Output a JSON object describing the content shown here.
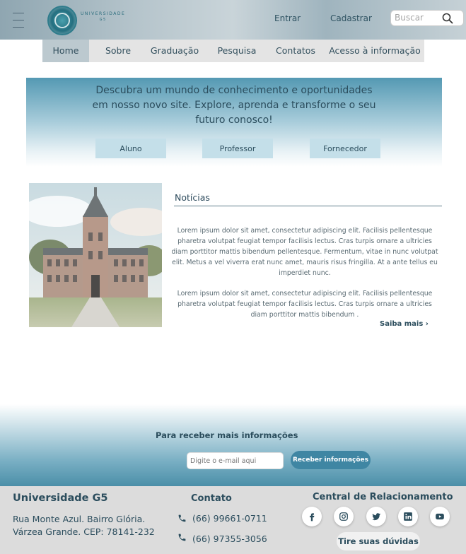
{
  "header": {
    "logo_text": "UNIVERSIDADE",
    "logo_sub": "G5",
    "login": "Entrar",
    "signup": "Cadastrar",
    "search_placeholder": "Buscar"
  },
  "nav": {
    "items": [
      {
        "label": "Home"
      },
      {
        "label": "Sobre"
      },
      {
        "label": "Graduação"
      },
      {
        "label": "Pesquisa"
      },
      {
        "label": "Contatos"
      },
      {
        "label": "Acesso à informação"
      }
    ],
    "active": "Home"
  },
  "hero": {
    "text": "Descubra um mundo de conhecimento e oportunidades em nosso novo site. Explore, aprenda e transforme o seu futuro conosco!",
    "buttons": [
      {
        "label": "Aluno"
      },
      {
        "label": "Professor"
      },
      {
        "label": "Fornecedor"
      }
    ]
  },
  "news": {
    "title": "Notícias",
    "paragraph1": "Lorem ipsum dolor sit amet, consectetur adipiscing elit. Facilisis pellentesque pharetra volutpat feugiat tempor facilisis lectus. Cras turpis ornare a ultricies diam porttitor mattis bibendum pellentesque. Fermentum, vitae in nunc volutpat elit. Metus a vel viverra erat nunc amet, mauris risus fringilla. At a ante tellus eu imperdiet nunc.",
    "paragraph2": "Lorem ipsum dolor sit amet, consectetur adipiscing elit. Facilisis pellentesque pharetra volutpat feugiat tempor facilisis lectus. Cras turpis ornare a ultricies diam porttitor mattis bibendum .",
    "more": "Saiba mais ›"
  },
  "newsletter": {
    "title": "Para receber mais informações",
    "email_placeholder": "Digite o e-mail aqui",
    "button": "Receber informações"
  },
  "footer": {
    "name": "Universidade G5",
    "address1": "Rua Monte Azul. Bairro Glória.",
    "address2": "Várzea Grande. CEP: 78141-232",
    "contact_title": "Contato",
    "phone1": "(66) 99661-0711",
    "phone2": "(66) 97355-3056",
    "relations_title": "Central de Relacionamento",
    "social": [
      "facebook-icon",
      "instagram-icon",
      "twitter-icon",
      "linkedin-icon",
      "youtube-icon"
    ],
    "help_button": "Tire suas dúvidas"
  },
  "colors": {
    "primary": "#2b4d5d",
    "accent": "#3f86a3",
    "hero_top": "#5499b3",
    "nav_active": "#bcc9cf"
  }
}
